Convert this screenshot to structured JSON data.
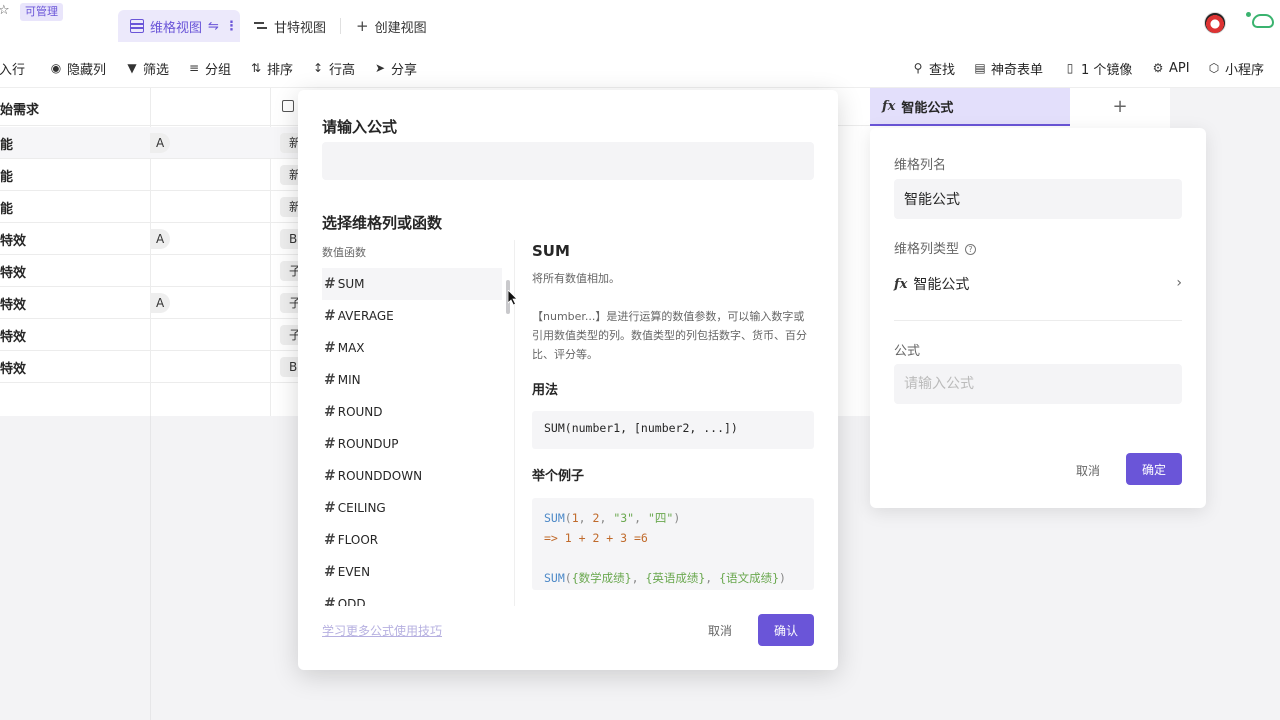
{
  "topbar": {
    "permission_badge": "可管理",
    "tabs": [
      {
        "label": "维格视图",
        "icon": "grid-view-icon",
        "active": true
      },
      {
        "label": "甘特视图",
        "icon": "gantt-view-icon",
        "active": false
      },
      {
        "label": "创建视图",
        "icon": "plus-icon",
        "active": false
      }
    ]
  },
  "toolbar": {
    "insert_row": "插入行",
    "hide_columns": "隐藏列",
    "filter": "筛选",
    "group": "分组",
    "sort": "排序",
    "row_height": "行高",
    "share": "分享",
    "search": "查找",
    "magic_form": "神奇表单",
    "mirror": "1 个镜像",
    "api": "API",
    "mini_program": "小程序"
  },
  "grid": {
    "header_first": "始需求",
    "rows": [
      {
        "text": "能",
        "tag_a": "A",
        "tag_b": "新"
      },
      {
        "text": "能",
        "tag_a": "",
        "tag_b": "新"
      },
      {
        "text": "能",
        "tag_a": "",
        "tag_b": "新"
      },
      {
        "text": "特效",
        "tag_a": "A",
        "tag_b": "B"
      },
      {
        "text": "特效",
        "tag_a": "",
        "tag_b": "子"
      },
      {
        "text": "特效",
        "tag_a": "A",
        "tag_b": "子"
      },
      {
        "text": "特效",
        "tag_a": "",
        "tag_b": "子"
      },
      {
        "text": "特效",
        "tag_a": "",
        "tag_b": "B"
      }
    ],
    "formula_column_header": "智能公式",
    "add_column": "+"
  },
  "field_panel": {
    "name_label": "维格列名",
    "name_value": "智能公式",
    "type_label": "维格列类型",
    "type_value": "智能公式",
    "formula_label": "公式",
    "formula_placeholder": "请输入公式",
    "cancel": "取消",
    "ok": "确定"
  },
  "modal": {
    "input_heading": "请输入公式",
    "select_heading": "选择维格列或函数",
    "category": "数值函数",
    "functions": [
      "SUM",
      "AVERAGE",
      "MAX",
      "MIN",
      "ROUND",
      "ROUNDUP",
      "ROUNDDOWN",
      "CEILING",
      "FLOOR",
      "EVEN",
      "ODD"
    ],
    "selected_function": "SUM",
    "doc": {
      "title": "SUM",
      "description": "将所有数值相加。",
      "params": "【number...】是进行运算的数值参数，可以输入数字或引用数值类型的列。数值类型的列包括数字、货币、百分比、评分等。",
      "usage_heading": "用法",
      "usage_code": "SUM(number1, [number2, ...])",
      "example_heading": "举个例子",
      "example_fn": "SUM",
      "example_args": [
        "1",
        "2",
        "\"3\"",
        "\"四\""
      ],
      "example_result": "=> 1 + 2 + 3 =6",
      "example2_fn": "SUM",
      "example2_fields": [
        "{数学成绩}",
        "{英语成绩}",
        "{语文成绩}"
      ]
    },
    "learn_more": "学习更多公式使用技巧",
    "cancel": "取消",
    "ok": "确认"
  },
  "colors": {
    "accent": "#6a55d8",
    "accent_light": "#ece9fb"
  }
}
